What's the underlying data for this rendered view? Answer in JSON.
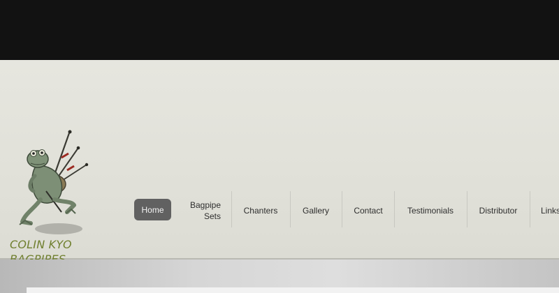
{
  "brand": {
    "line1": "COLIN KYO",
    "line2": "BAGPIPES",
    "color": "#6f7f2e"
  },
  "nav": {
    "active": "Home",
    "items": [
      {
        "label": "Home"
      },
      {
        "label_line1": "Bagpipe",
        "label_line2": "Sets"
      },
      {
        "label": "Chanters"
      },
      {
        "label": "Gallery"
      },
      {
        "label": "Contact"
      },
      {
        "label": "Testimonials"
      },
      {
        "label": "Distributor"
      },
      {
        "label": "Links"
      }
    ]
  },
  "colors": {
    "top_bar": "#121212",
    "header_bg": "#e3e3dc",
    "active_tab_bg": "#616161",
    "nav_text": "#2e2e2e"
  }
}
